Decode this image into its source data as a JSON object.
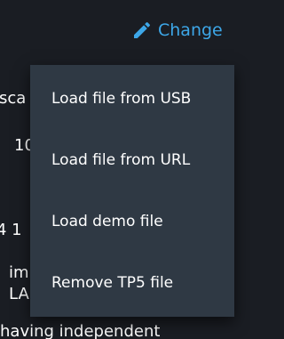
{
  "header": {
    "change_label": "Change",
    "change_icon": "pencil-icon",
    "accent_color": "#3da7e8"
  },
  "background_text": {
    "fragment_1": "sca",
    "fragment_2": "10",
    "fragment_3": "4 1",
    "fragment_4": "im",
    "fragment_5": "LA",
    "bottom_line": "having independent"
  },
  "menu": {
    "items": [
      {
        "label": "Load file from USB"
      },
      {
        "label": "Load file from URL"
      },
      {
        "label": "Load demo file"
      },
      {
        "label": "Remove TP5 file"
      }
    ]
  }
}
